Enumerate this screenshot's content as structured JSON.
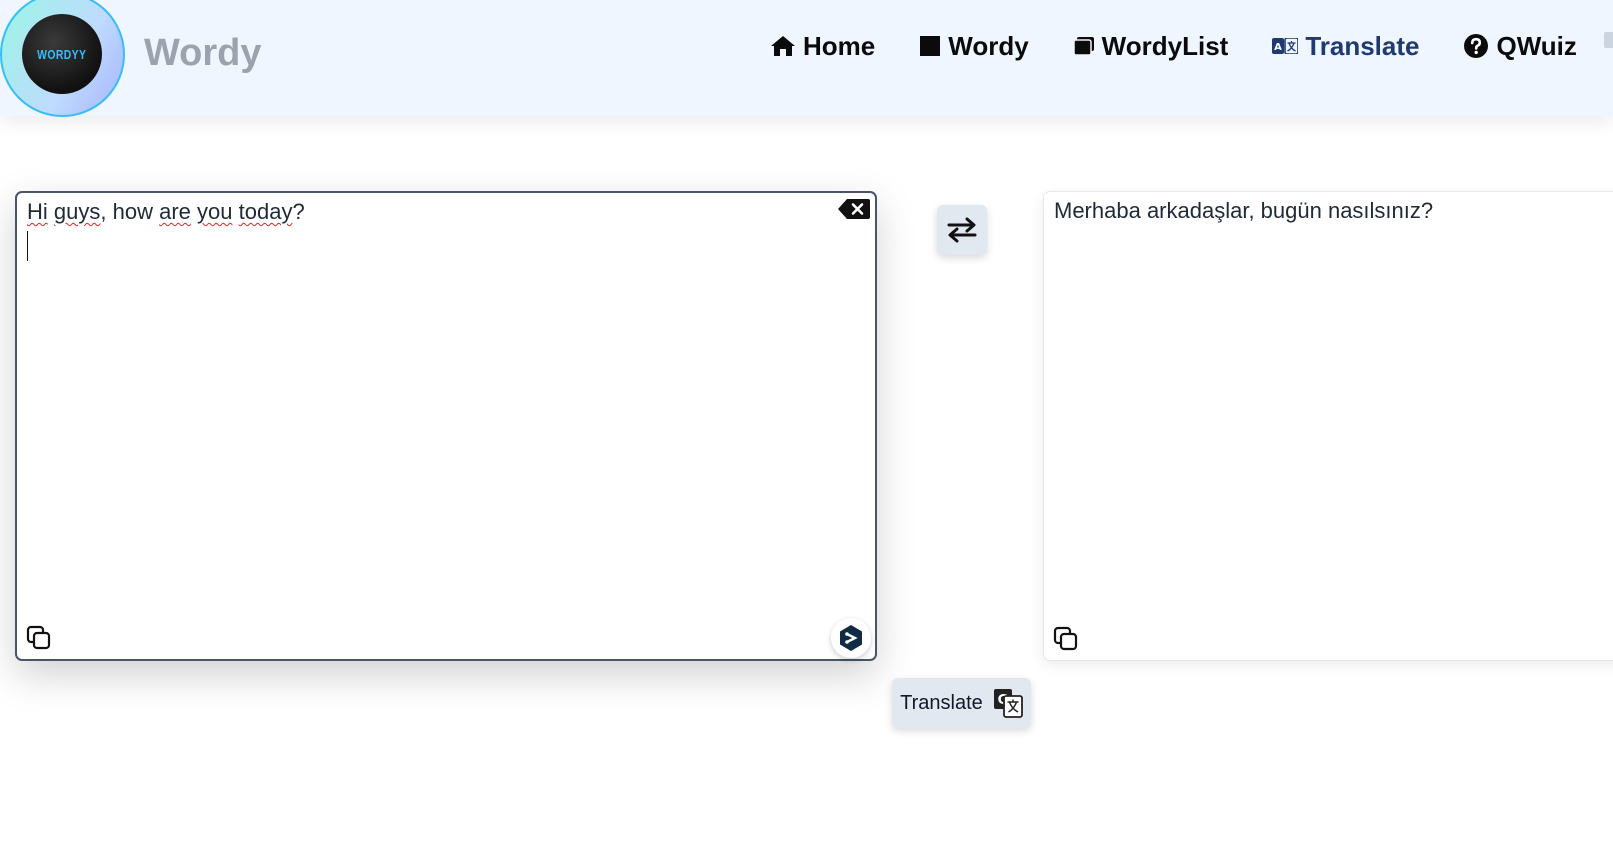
{
  "brand": {
    "logo_text": "WORDYY",
    "name": "Wordy"
  },
  "nav": {
    "items": [
      {
        "label": "Home",
        "icon": "home-icon"
      },
      {
        "label": "Wordy",
        "icon": "square-icon"
      },
      {
        "label": "WordyList",
        "icon": "stack-icon"
      },
      {
        "label": "Translate",
        "icon": "language-icon",
        "active": true
      },
      {
        "label": "QWuiz",
        "icon": "question-circle-icon"
      }
    ]
  },
  "source": {
    "text_parts": [
      "Hi",
      " ",
      "guys",
      ", how ",
      "are",
      " ",
      "you",
      " ",
      "today",
      "?"
    ]
  },
  "target": {
    "text": "Merhaba arkadaşlar, bugün nasılsınız?"
  },
  "actions": {
    "translate_label": "Translate"
  },
  "colors": {
    "navbar_bg": "#eff6ff",
    "active_nav": "#1e3a6e",
    "brand_text": "#9ca3af",
    "button_bg": "#e2e8f0",
    "source_border": "#475569"
  }
}
